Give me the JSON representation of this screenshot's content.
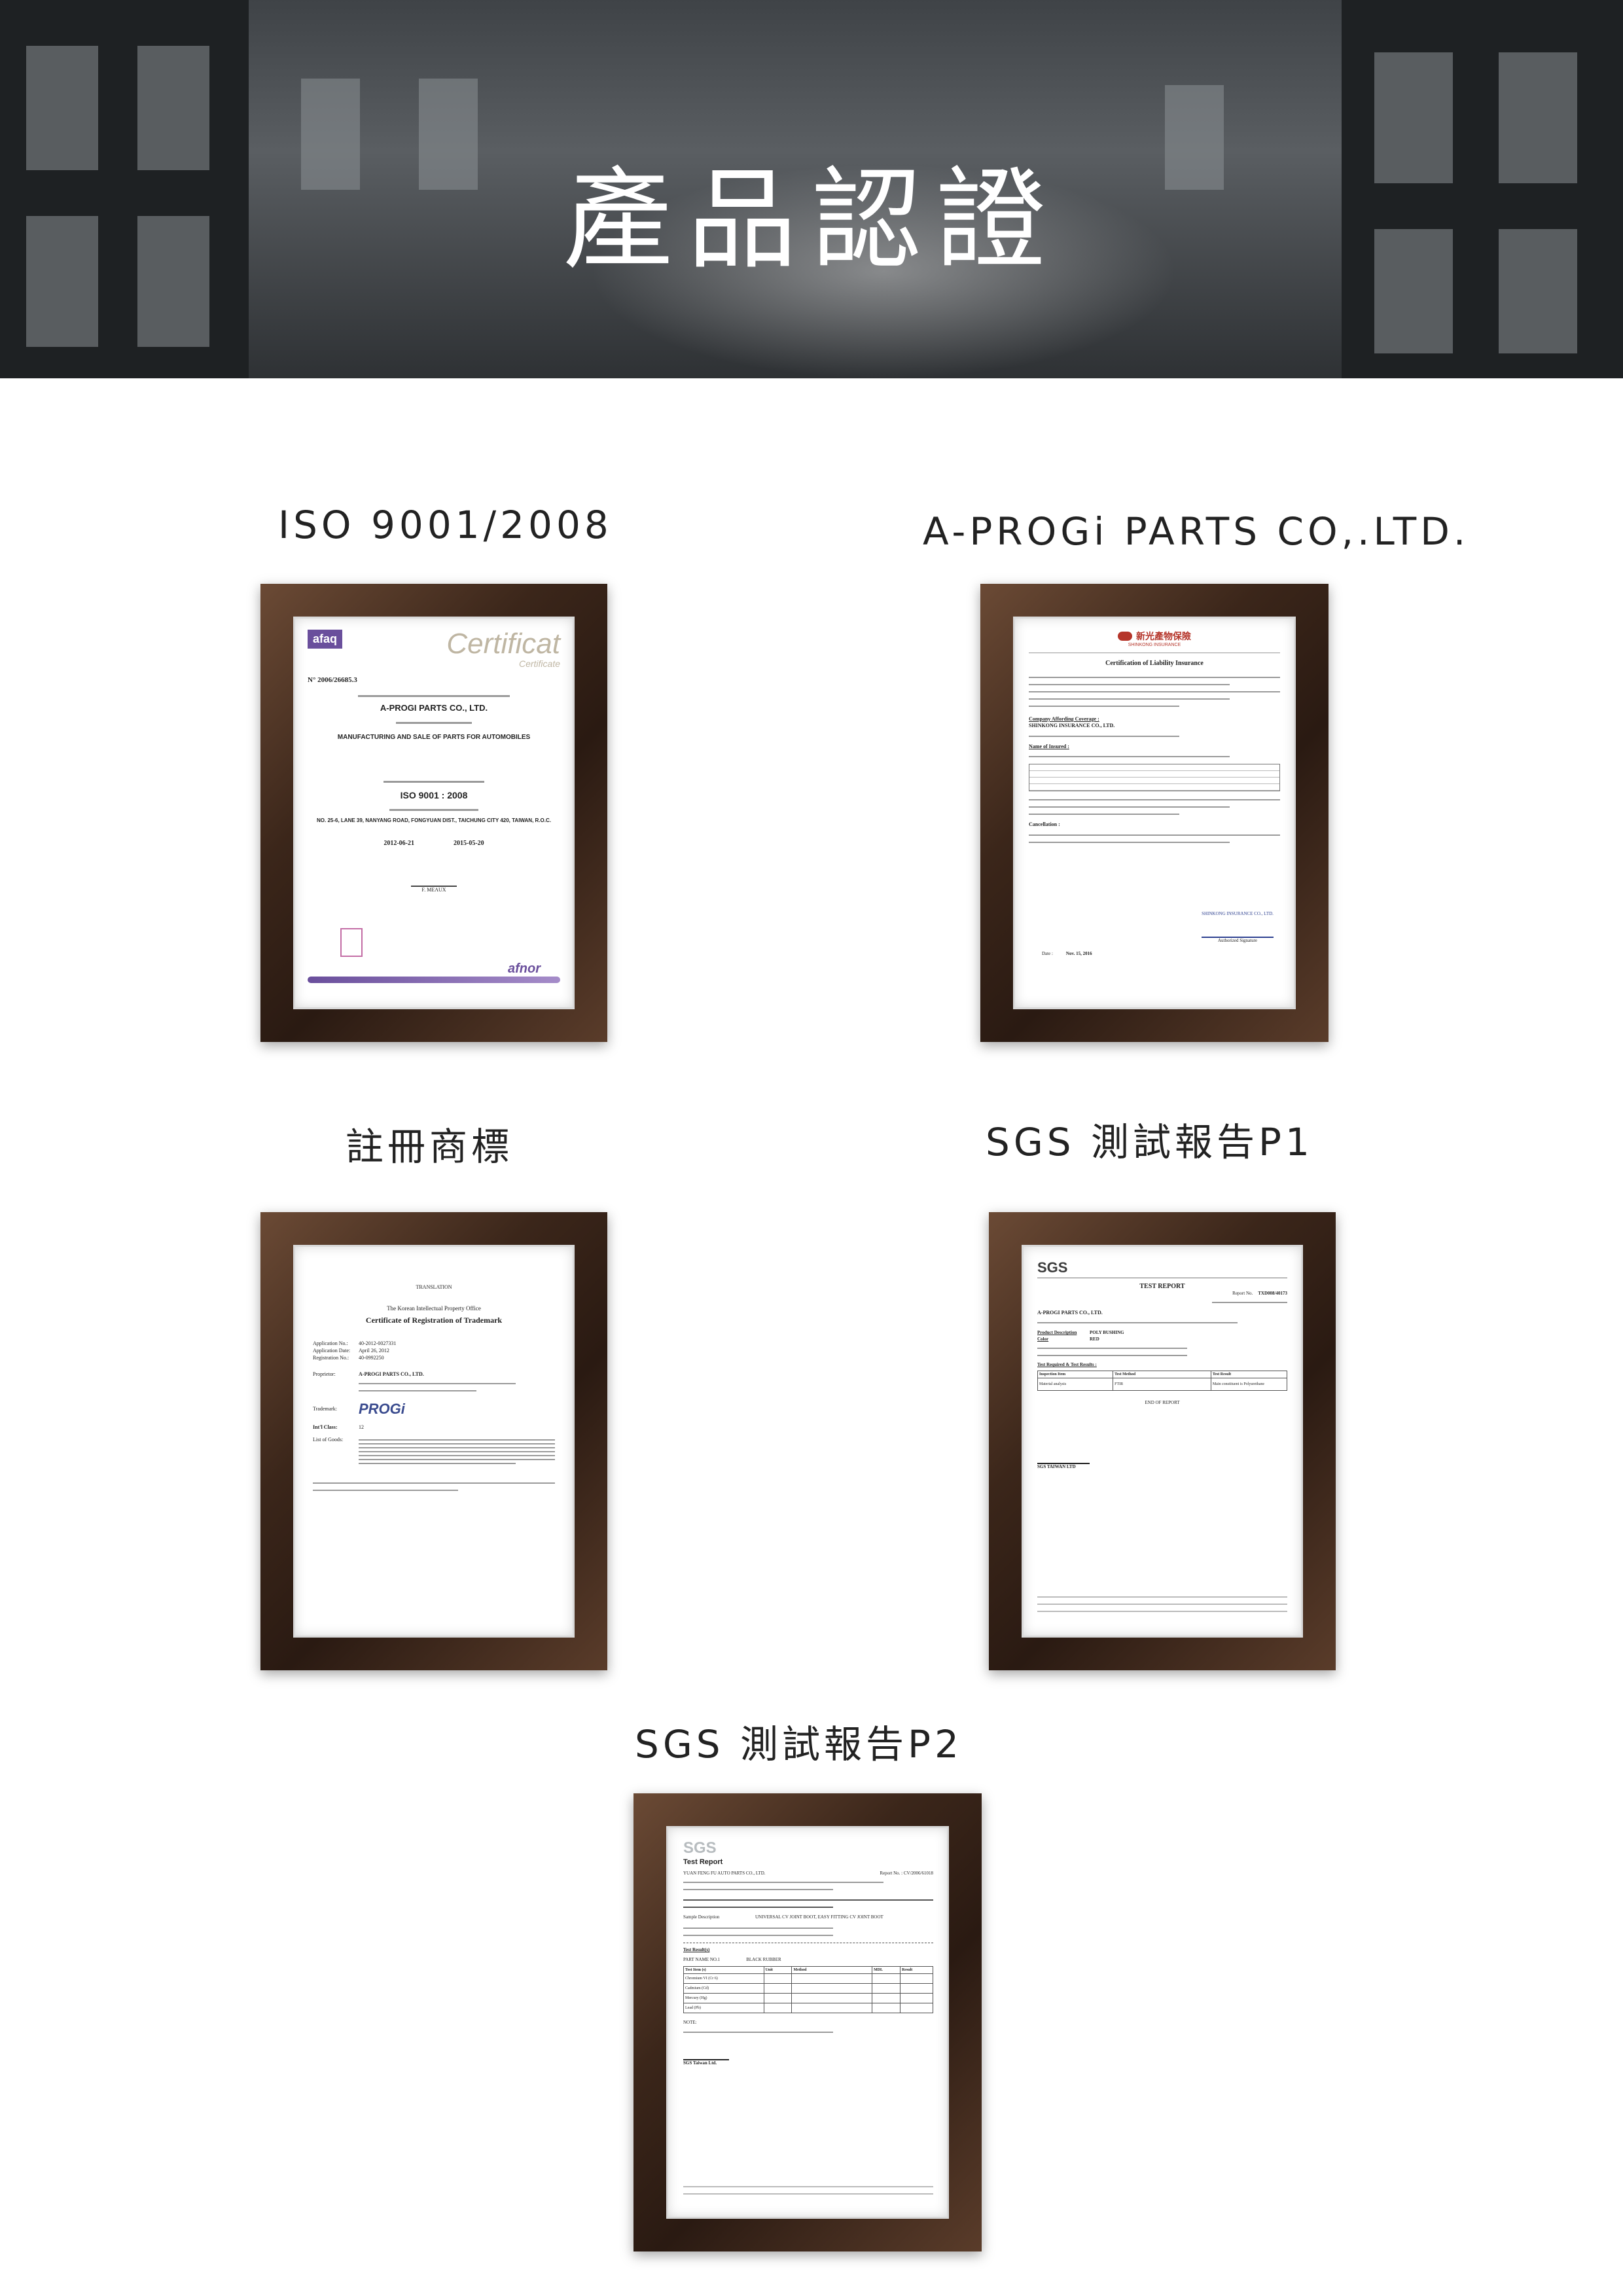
{
  "banner": {
    "title": "產品認證"
  },
  "certificates": [
    {
      "caption": "ISO 9001/2008",
      "doc": {
        "logo": "afaq",
        "heading": "Certificat",
        "subheading": "Certificate",
        "number": "N° 2006/26685.3",
        "company": "A-PROGI PARTS CO., LTD.",
        "scope": "MANUFACTURING AND SALE OF PARTS FOR AUTOMOBILES",
        "standard": "ISO 9001 : 2008",
        "address": "NO. 25-6, LANE 39, NANYANG ROAD, FONGYUAN DIST., TAICHUNG CITY 420, TAIWAN, R.O.C.",
        "date_from": "2012-06-21",
        "date_to": "2015-05-20",
        "signatory": "F. MEAUX",
        "footer_brand": "afnor"
      }
    },
    {
      "caption": "A-PROGi PARTS CO,.LTD.",
      "doc": {
        "insurer_cn": "新光產物保險",
        "insurer_en": "SHINKONG INSURANCE",
        "heading": "Certification of Liability Insurance",
        "coverage_label": "Company Affording Coverage :",
        "coverage_name": "SHINKONG INSURANCE CO., LTD.",
        "insured_label": "Name of Insured :",
        "cancel_label": "Cancellation :",
        "sign_company": "SHINKONG INSURANCE CO., LTD.",
        "sign_title": "Authorized Signature",
        "date_label": "Date :",
        "date": "Nov. 15, 2016"
      }
    },
    {
      "caption": "註冊商標",
      "doc": {
        "top": "TRANSLATION",
        "office": "The Korean Intellectual Property Office",
        "heading": "Certificate of Registration of Trademark",
        "app_no_label": "Application No.:",
        "app_no": "40-2012-0027331",
        "app_date_label": "Application Date:",
        "app_date": "April 26, 2012",
        "reg_no_label": "Registration No.:",
        "reg_no": "40-0992250",
        "proprietor_label": "Proprietor:",
        "proprietor": "A-PROGI PARTS CO., LTD.",
        "trademark_label": "Trademark:",
        "trademark": "PROGi",
        "class_label": "Int'l Class:",
        "class": "12",
        "goods_label": "List of Goods:"
      }
    },
    {
      "caption": "SGS 測試報告P1",
      "doc": {
        "logo": "SGS",
        "heading": "TEST REPORT",
        "report_no_label": "Report No.",
        "report_no": "TXD008/40173",
        "company": "A-PROGI PARTS CO., LTD.",
        "product_label": "Product Description",
        "product": "POLY BUSHING",
        "color_label": "Color",
        "color": "RED",
        "results_label": "Test Required & Test Results :",
        "col1": "Inspection Item",
        "col2": "Test Method",
        "col3": "Test Result",
        "row_item": "Material analysis",
        "row_method": "FTIR",
        "row_result": "Main constituent is Polyurethane",
        "end": "END OF REPORT",
        "signer": "SGS TAIWAN LTD"
      }
    },
    {
      "caption": "SGS 測試報告P2",
      "doc": {
        "logo": "SGS",
        "heading": "Test Report",
        "company": "YUAN FENG FU AUTO PARTS CO., LTD.",
        "report_no_label": "Report No.",
        "report_no": "CV/2006/61018",
        "sample_label": "Sample Description",
        "sample": "UNIVERSAL CV JOINT BOOT, EASY FITTING CV JOINT BOOT",
        "results_label": "Test Result(s)",
        "part_label": "PART NAME NO.1",
        "part": "BLACK RUBBER",
        "col1": "Test Item (s)",
        "col2": "Unit",
        "col3": "Method",
        "col4": "MDL",
        "col5": "Result",
        "rows": [
          "Chromium VI (Cr 6)",
          "Cadmium (Cd)",
          "Mercury (Hg)",
          "Lead (Pb)"
        ],
        "note": "NOTE:",
        "signer": "SGS Taiwan Ltd."
      }
    }
  ]
}
